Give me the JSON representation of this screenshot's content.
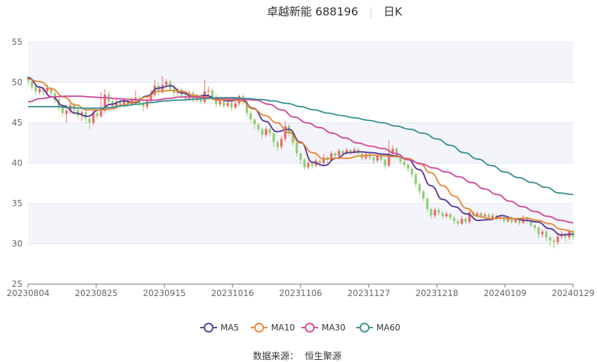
{
  "chart_data": {
    "type": "candlestick",
    "title_name": "卓越新能",
    "title_code": "688196",
    "period_label": "日K",
    "y_ticks": [
      25,
      30,
      35,
      40,
      45,
      50,
      55
    ],
    "ylim": [
      25,
      55
    ],
    "x_tick_labels": [
      "20230804",
      "20230825",
      "20230915",
      "20231016",
      "20231106",
      "20231127",
      "20231218",
      "20240109",
      "20240129"
    ],
    "grid": true,
    "legend_position": "bottom",
    "source_label": "数据来源：",
    "source_value": "恒生聚源",
    "colors": {
      "up": "#ee6666",
      "down": "#91cc75",
      "band": "#f4f5fb",
      "grid": "#e0e6f1"
    },
    "series": [
      {
        "name": "MA5",
        "color": "#5b3a9a",
        "values": [
          50.6,
          49.4,
          48.2,
          47.1,
          46.2,
          45.8,
          46.6,
          47.3,
          47.7,
          47.5,
          48.3,
          49.3,
          49.6,
          48.7,
          48.2,
          48.4,
          47.9,
          47.7,
          47.9,
          46.8,
          45.2,
          43.9,
          44.2,
          42.6,
          40.1,
          39.7,
          40.6,
          41.3,
          41.4,
          41.3,
          41.1,
          40.9,
          40.5,
          39.2,
          37.2,
          35.5,
          34.6,
          33.7,
          32.9,
          33.0,
          33.5,
          33.1,
          32.9,
          32.7,
          31.9,
          31.1,
          31.2
        ]
      },
      {
        "name": "MA10",
        "color": "#e38b3c",
        "values": [
          50.4,
          50.1,
          49.2,
          48.2,
          47.2,
          46.6,
          46.6,
          46.7,
          47.2,
          47.6,
          48.2,
          48.9,
          49.0,
          48.9,
          48.4,
          48.2,
          47.8,
          47.9,
          47.7,
          46.7,
          45.9,
          45.0,
          43.8,
          42.5,
          41.3,
          40.5,
          40.6,
          40.6,
          40.9,
          41.0,
          40.9,
          40.8,
          40.6,
          40.0,
          38.8,
          37.2,
          35.9,
          34.4,
          33.4,
          33.1,
          33.2,
          33.1,
          33.2,
          32.9,
          32.5,
          31.8,
          31.5
        ]
      },
      {
        "name": "MA30",
        "color": "#d14d9d",
        "values": [
          47.6,
          48.0,
          48.2,
          48.3,
          48.3,
          48.2,
          48.1,
          48.0,
          47.9,
          47.8,
          47.8,
          48.0,
          48.2,
          48.2,
          48.1,
          48.0,
          48.0,
          47.9,
          47.8,
          47.3,
          46.6,
          45.7,
          45.0,
          44.4,
          43.7,
          43.1,
          42.5,
          42.1,
          41.8,
          41.2,
          40.4,
          39.9,
          39.4,
          38.9,
          38.3,
          37.6,
          36.8,
          36.1,
          35.3,
          34.6,
          34.0,
          33.4,
          32.9,
          32.6
        ]
      },
      {
        "name": "MA60",
        "color": "#3f9394",
        "values": [
          47.0,
          47.0,
          47.0,
          46.9,
          46.8,
          46.8,
          46.9,
          47.1,
          47.3,
          47.5,
          47.7,
          47.8,
          47.9,
          48.0,
          48.1,
          48.1,
          48.0,
          47.9,
          47.7,
          47.4,
          47.0,
          46.6,
          46.2,
          45.9,
          45.6,
          45.3,
          45.0,
          44.6,
          44.2,
          43.7,
          43.0,
          42.2,
          41.3,
          40.5,
          39.7,
          38.9,
          38.2,
          37.6,
          37.0,
          36.3,
          36.1
        ]
      }
    ],
    "candles": [
      [
        50.7,
        50.2,
        50.8,
        49.6
      ],
      [
        50.1,
        49.4,
        50.3,
        49.0
      ],
      [
        49.5,
        48.9,
        49.7,
        48.4
      ],
      [
        48.8,
        49.2,
        49.6,
        48.5
      ],
      [
        49.2,
        48.8,
        49.5,
        48.4
      ],
      [
        48.9,
        49.3,
        49.7,
        48.6
      ],
      [
        49.3,
        48.7,
        49.5,
        48.3
      ],
      [
        48.6,
        47.8,
        48.9,
        47.4
      ],
      [
        47.9,
        46.9,
        48.2,
        46.5
      ],
      [
        47.0,
        46.2,
        47.3,
        45.8
      ],
      [
        46.1,
        46.5,
        46.9,
        45.0
      ],
      [
        46.5,
        47.2,
        47.8,
        46.1
      ],
      [
        47.2,
        46.6,
        47.5,
        46.0
      ],
      [
        46.6,
        45.9,
        46.9,
        45.4
      ],
      [
        45.9,
        46.3,
        46.6,
        45.2
      ],
      [
        46.3,
        45.6,
        46.6,
        44.9
      ],
      [
        45.5,
        45.0,
        45.9,
        44.2
      ],
      [
        45.0,
        46.2,
        46.5,
        44.7
      ],
      [
        46.2,
        45.8,
        46.6,
        45.4
      ],
      [
        45.8,
        46.5,
        48.8,
        45.6
      ],
      [
        46.5,
        48.5,
        49.2,
        46.2
      ],
      [
        48.5,
        47.6,
        48.9,
        47.2
      ],
      [
        47.7,
        47.0,
        48.0,
        46.6
      ],
      [
        47.0,
        47.6,
        47.9,
        46.7
      ],
      [
        47.6,
        47.1,
        47.9,
        46.8
      ],
      [
        47.1,
        47.8,
        48.1,
        46.9
      ],
      [
        47.8,
        47.3,
        48.1,
        47.0
      ],
      [
        47.3,
        47.8,
        48.2,
        47.1
      ],
      [
        47.8,
        48.1,
        49.0,
        47.5
      ],
      [
        48.1,
        47.4,
        48.4,
        47.0
      ],
      [
        47.4,
        47.0,
        47.7,
        46.4
      ],
      [
        47.0,
        47.7,
        48.0,
        46.7
      ],
      [
        47.7,
        48.5,
        49.1,
        47.4
      ],
      [
        48.5,
        49.6,
        50.3,
        48.2
      ],
      [
        49.6,
        48.8,
        50.0,
        48.4
      ],
      [
        48.8,
        49.7,
        50.8,
        48.6
      ],
      [
        49.7,
        50.1,
        50.4,
        49.2
      ],
      [
        50.1,
        49.2,
        50.3,
        48.8
      ],
      [
        49.2,
        48.7,
        49.4,
        48.3
      ],
      [
        48.7,
        49.1,
        49.4,
        48.4
      ],
      [
        49.1,
        48.4,
        49.3,
        48.0
      ],
      [
        48.4,
        48.0,
        48.7,
        47.6
      ],
      [
        48.0,
        48.7,
        49.0,
        47.7
      ],
      [
        48.7,
        47.9,
        49.0,
        47.5
      ],
      [
        47.9,
        48.3,
        48.6,
        47.6
      ],
      [
        48.3,
        47.6,
        48.6,
        47.3
      ],
      [
        47.6,
        48.9,
        50.3,
        47.3
      ],
      [
        48.9,
        49.0,
        49.5,
        48.3
      ],
      [
        49.0,
        48.2,
        49.3,
        47.8
      ],
      [
        48.2,
        47.3,
        48.5,
        46.9
      ],
      [
        47.3,
        47.7,
        48.1,
        47.0
      ],
      [
        47.7,
        47.1,
        48.0,
        46.8
      ],
      [
        47.1,
        47.5,
        47.8,
        46.9
      ],
      [
        47.5,
        46.9,
        47.7,
        46.5
      ],
      [
        46.9,
        47.4,
        47.8,
        46.6
      ],
      [
        47.4,
        48.3,
        48.5,
        47.1
      ],
      [
        48.3,
        47.6,
        48.6,
        47.2
      ],
      [
        47.6,
        46.2,
        47.8,
        45.8
      ],
      [
        46.2,
        45.4,
        46.5,
        45.0
      ],
      [
        45.4,
        44.8,
        45.6,
        44.2
      ],
      [
        44.8,
        44.2,
        45.0,
        43.8
      ],
      [
        44.2,
        43.5,
        44.4,
        43.0
      ],
      [
        43.5,
        44.2,
        44.5,
        43.2
      ],
      [
        44.2,
        43.7,
        44.4,
        43.3
      ],
      [
        43.7,
        42.6,
        43.9,
        42.0
      ],
      [
        42.6,
        42.0,
        42.9,
        41.5
      ],
      [
        42.0,
        43.0,
        43.3,
        41.7
      ],
      [
        43.0,
        44.6,
        45.2,
        42.7
      ],
      [
        44.6,
        43.8,
        44.9,
        43.3
      ],
      [
        43.8,
        42.5,
        44.0,
        42.1
      ],
      [
        42.5,
        41.2,
        42.7,
        40.8
      ],
      [
        41.2,
        40.4,
        41.4,
        39.8
      ],
      [
        40.4,
        39.5,
        40.6,
        39.1
      ],
      [
        39.5,
        40.0,
        40.3,
        39.2
      ],
      [
        40.0,
        39.7,
        40.2,
        39.3
      ],
      [
        39.7,
        40.3,
        40.6,
        39.5
      ],
      [
        40.3,
        40.0,
        40.5,
        39.6
      ],
      [
        40.0,
        40.7,
        41.1,
        39.8
      ],
      [
        40.7,
        40.4,
        40.9,
        40.0
      ],
      [
        40.4,
        41.2,
        41.5,
        40.2
      ],
      [
        41.2,
        40.9,
        41.4,
        40.5
      ],
      [
        40.9,
        41.5,
        41.8,
        40.7
      ],
      [
        41.5,
        41.2,
        41.7,
        40.9
      ],
      [
        41.2,
        41.6,
        41.9,
        41.0
      ],
      [
        41.6,
        41.3,
        41.8,
        41.0
      ],
      [
        41.3,
        41.7,
        42.0,
        41.1
      ],
      [
        41.7,
        41.2,
        41.9,
        40.9
      ],
      [
        41.2,
        40.6,
        41.4,
        40.3
      ],
      [
        40.6,
        41.1,
        41.3,
        40.4
      ],
      [
        41.1,
        40.7,
        41.3,
        40.4
      ],
      [
        40.7,
        40.3,
        40.9,
        39.9
      ],
      [
        40.3,
        41.0,
        41.2,
        40.1
      ],
      [
        41.0,
        40.4,
        41.2,
        40.1
      ],
      [
        40.4,
        39.7,
        40.6,
        39.3
      ],
      [
        39.7,
        41.2,
        42.8,
        39.5
      ],
      [
        41.2,
        41.8,
        42.2,
        40.9
      ],
      [
        41.8,
        40.8,
        42.0,
        40.5
      ],
      [
        40.8,
        40.2,
        41.0,
        39.8
      ],
      [
        40.2,
        39.8,
        40.4,
        39.4
      ],
      [
        39.8,
        39.3,
        40.0,
        38.9
      ],
      [
        39.3,
        38.6,
        39.5,
        38.2
      ],
      [
        38.6,
        37.4,
        38.8,
        37.0
      ],
      [
        37.4,
        36.5,
        37.6,
        36.1
      ],
      [
        36.5,
        35.6,
        36.7,
        35.2
      ],
      [
        35.6,
        34.3,
        35.8,
        33.9
      ],
      [
        34.3,
        33.5,
        34.5,
        33.1
      ],
      [
        33.5,
        34.2,
        34.5,
        33.2
      ],
      [
        34.2,
        33.8,
        34.4,
        33.5
      ],
      [
        33.8,
        33.4,
        34.0,
        33.0
      ],
      [
        33.4,
        33.7,
        34.0,
        33.2
      ],
      [
        33.7,
        33.2,
        33.9,
        32.9
      ],
      [
        33.2,
        32.8,
        33.5,
        32.4
      ],
      [
        32.8,
        32.5,
        33.0,
        32.1
      ],
      [
        32.5,
        33.1,
        33.4,
        32.3
      ],
      [
        33.1,
        32.7,
        33.3,
        32.4
      ],
      [
        32.7,
        33.9,
        34.1,
        32.5
      ],
      [
        33.9,
        33.5,
        34.1,
        33.2
      ],
      [
        33.5,
        33.8,
        34.0,
        33.3
      ],
      [
        33.8,
        33.4,
        34.0,
        33.1
      ],
      [
        33.4,
        33.6,
        33.9,
        33.2
      ],
      [
        33.6,
        33.2,
        33.8,
        32.9
      ],
      [
        33.2,
        33.5,
        33.8,
        33.0
      ],
      [
        33.5,
        33.1,
        33.7,
        32.8
      ],
      [
        33.1,
        33.3,
        33.6,
        32.9
      ],
      [
        33.3,
        32.8,
        33.5,
        32.5
      ],
      [
        32.8,
        33.2,
        33.4,
        32.6
      ],
      [
        33.2,
        32.7,
        33.4,
        32.4
      ],
      [
        32.7,
        33.0,
        33.2,
        32.5
      ],
      [
        33.0,
        32.6,
        33.2,
        32.3
      ],
      [
        32.6,
        33.2,
        33.5,
        32.4
      ],
      [
        33.2,
        32.8,
        33.4,
        32.5
      ],
      [
        32.8,
        32.3,
        33.0,
        32.0
      ],
      [
        32.3,
        32.0,
        32.5,
        31.6
      ],
      [
        32.0,
        31.2,
        32.2,
        30.6
      ],
      [
        31.2,
        31.5,
        31.8,
        30.8
      ],
      [
        31.5,
        30.8,
        31.7,
        30.2
      ],
      [
        30.8,
        30.4,
        31.0,
        29.7
      ],
      [
        30.4,
        30.2,
        30.6,
        29.4
      ],
      [
        30.2,
        30.9,
        31.4,
        29.9
      ],
      [
        30.9,
        31.2,
        31.6,
        30.6
      ],
      [
        31.2,
        30.8,
        31.4,
        30.3
      ],
      [
        30.8,
        31.5,
        31.8,
        30.5
      ],
      [
        31.5,
        30.9,
        31.8,
        30.5
      ]
    ]
  }
}
